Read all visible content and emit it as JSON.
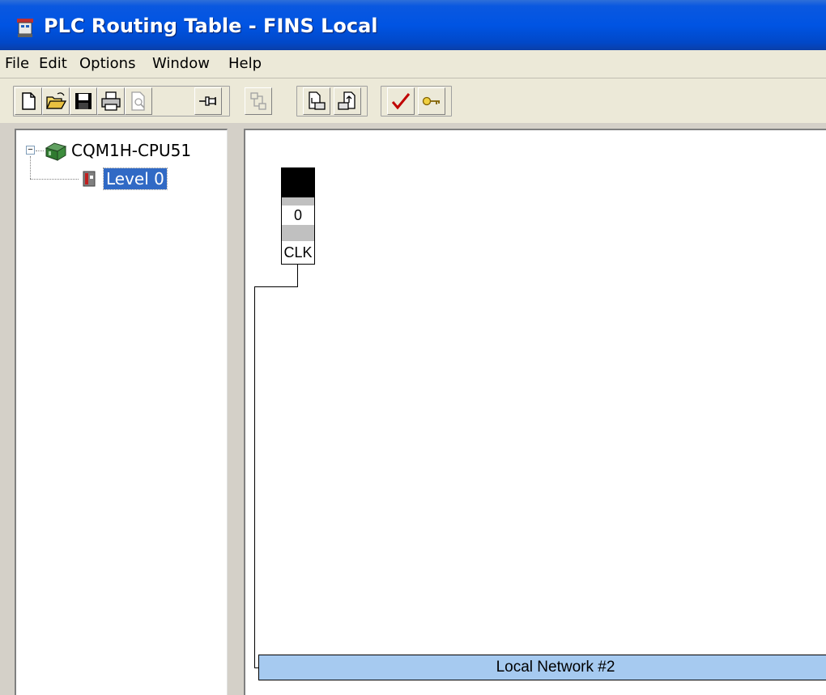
{
  "window": {
    "title": "PLC Routing Table - FINS Local"
  },
  "menu": [
    "File",
    "Edit",
    "Options",
    "Window",
    "Help"
  ],
  "toolbar": {
    "buttons": [
      {
        "name": "new-icon",
        "enabled": true
      },
      {
        "name": "open-icon",
        "enabled": true
      },
      {
        "name": "save-icon",
        "enabled": true
      },
      {
        "name": "print-icon",
        "enabled": true
      },
      {
        "name": "print-preview-icon",
        "enabled": false
      },
      {
        "name": "pin-icon",
        "enabled": true
      },
      {
        "name": "network-settings-icon",
        "enabled": false
      },
      {
        "name": "transfer-to-plc-icon",
        "enabled": true
      },
      {
        "name": "transfer-from-plc-icon",
        "enabled": true
      },
      {
        "name": "check-icon",
        "enabled": true
      },
      {
        "name": "key-icon",
        "enabled": true
      }
    ]
  },
  "tree": {
    "root": {
      "label": "CQM1H-CPU51",
      "expanded": true,
      "icon": "plc-icon"
    },
    "children": [
      {
        "label": "Level 0",
        "selected": true,
        "icon": "level-icon"
      }
    ]
  },
  "diagram": {
    "unit": {
      "node": "0",
      "label": "CLK"
    },
    "network": {
      "label": "Local Network #2"
    }
  },
  "colors": {
    "title_bar": "#0054e3",
    "selection": "#316ac5",
    "network_bar": "#a6caf0"
  }
}
